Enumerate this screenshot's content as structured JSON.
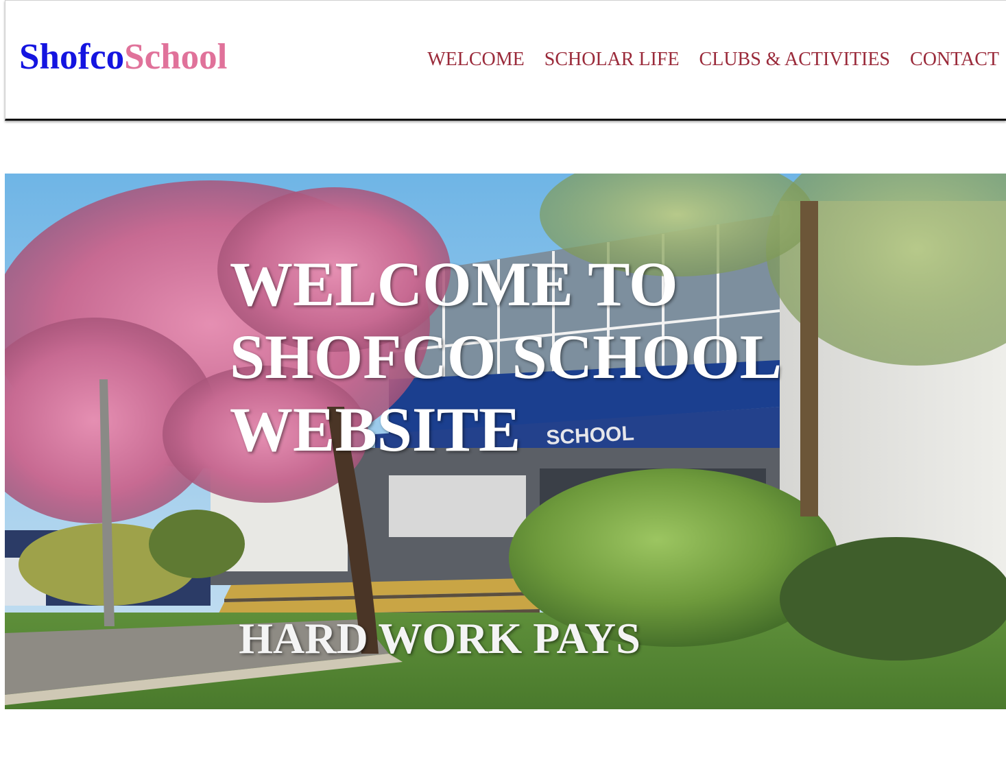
{
  "header": {
    "logo": {
      "part1": "Shofco",
      "part2": "School",
      "colors": {
        "part1": "#1414e0",
        "part2": "#e0729a"
      }
    },
    "nav": [
      {
        "label": "WELCOME"
      },
      {
        "label": "SCHOLAR LIFE"
      },
      {
        "label": "CLUBS & ACTIVITIES"
      },
      {
        "label": "CONTACT"
      }
    ],
    "nav_color": "#9a2a3a"
  },
  "hero": {
    "image": "school-building-photo",
    "title": "WELCOME TO SHOFCO SCHOOL WEBSITE",
    "tagline": "HARD WORK PAYS",
    "sign_text": "SCHOOL"
  }
}
